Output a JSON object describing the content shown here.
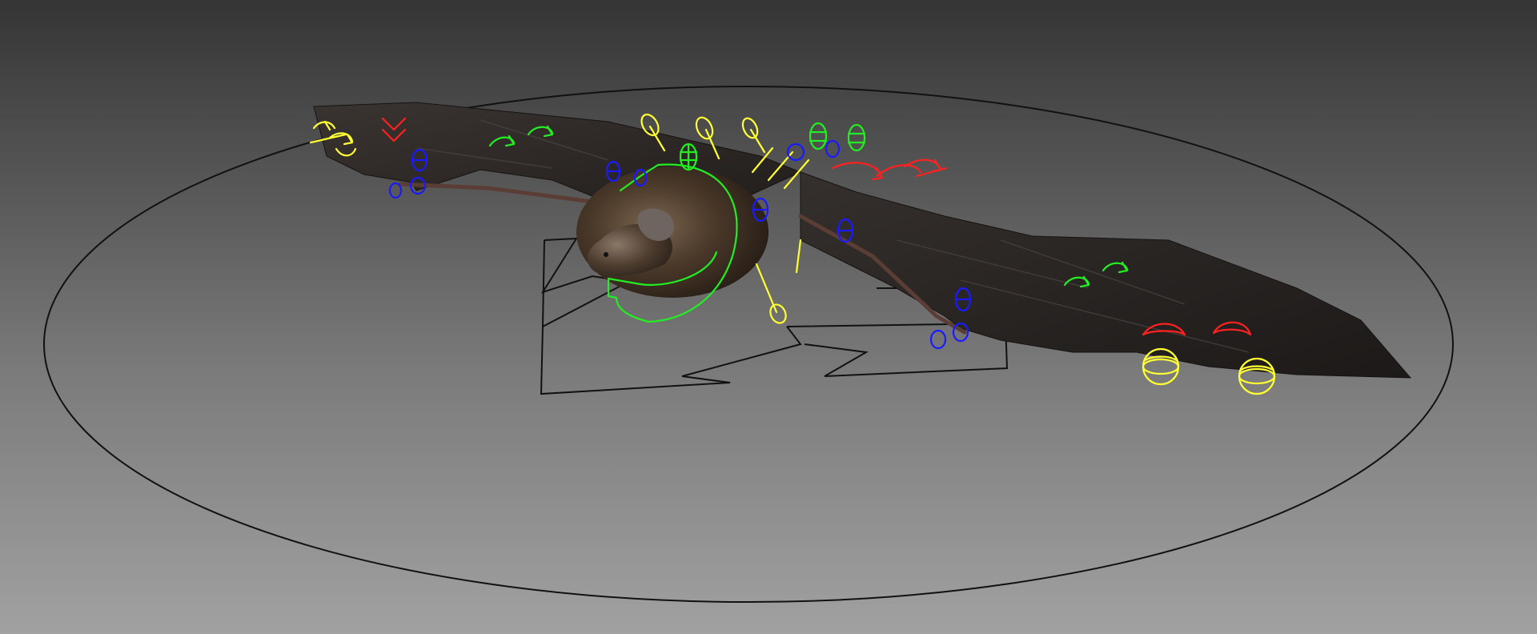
{
  "viewport": {
    "background_top": "#353535",
    "background_bottom": "#a1a1a1"
  },
  "colors": {
    "ground_circle": "#111111",
    "bat_wing": "#2b2725",
    "bat_wing_edge": "#1a1716",
    "bat_body": "#4a3a2c",
    "bat_body_highlight": "#6b5a48",
    "bat_arm": "#5a3e35",
    "control_yellow": "#ffff33",
    "control_red": "#ff2020",
    "control_green": "#22ee22",
    "control_blue": "#1a1aff",
    "root_control": "#111111"
  },
  "icons": {
    "root_arrow": "arrow-shaped-root-control",
    "rotate": "rotate-arrow-control",
    "lollipop": "lollipop-control",
    "sphere": "sphere-control"
  }
}
